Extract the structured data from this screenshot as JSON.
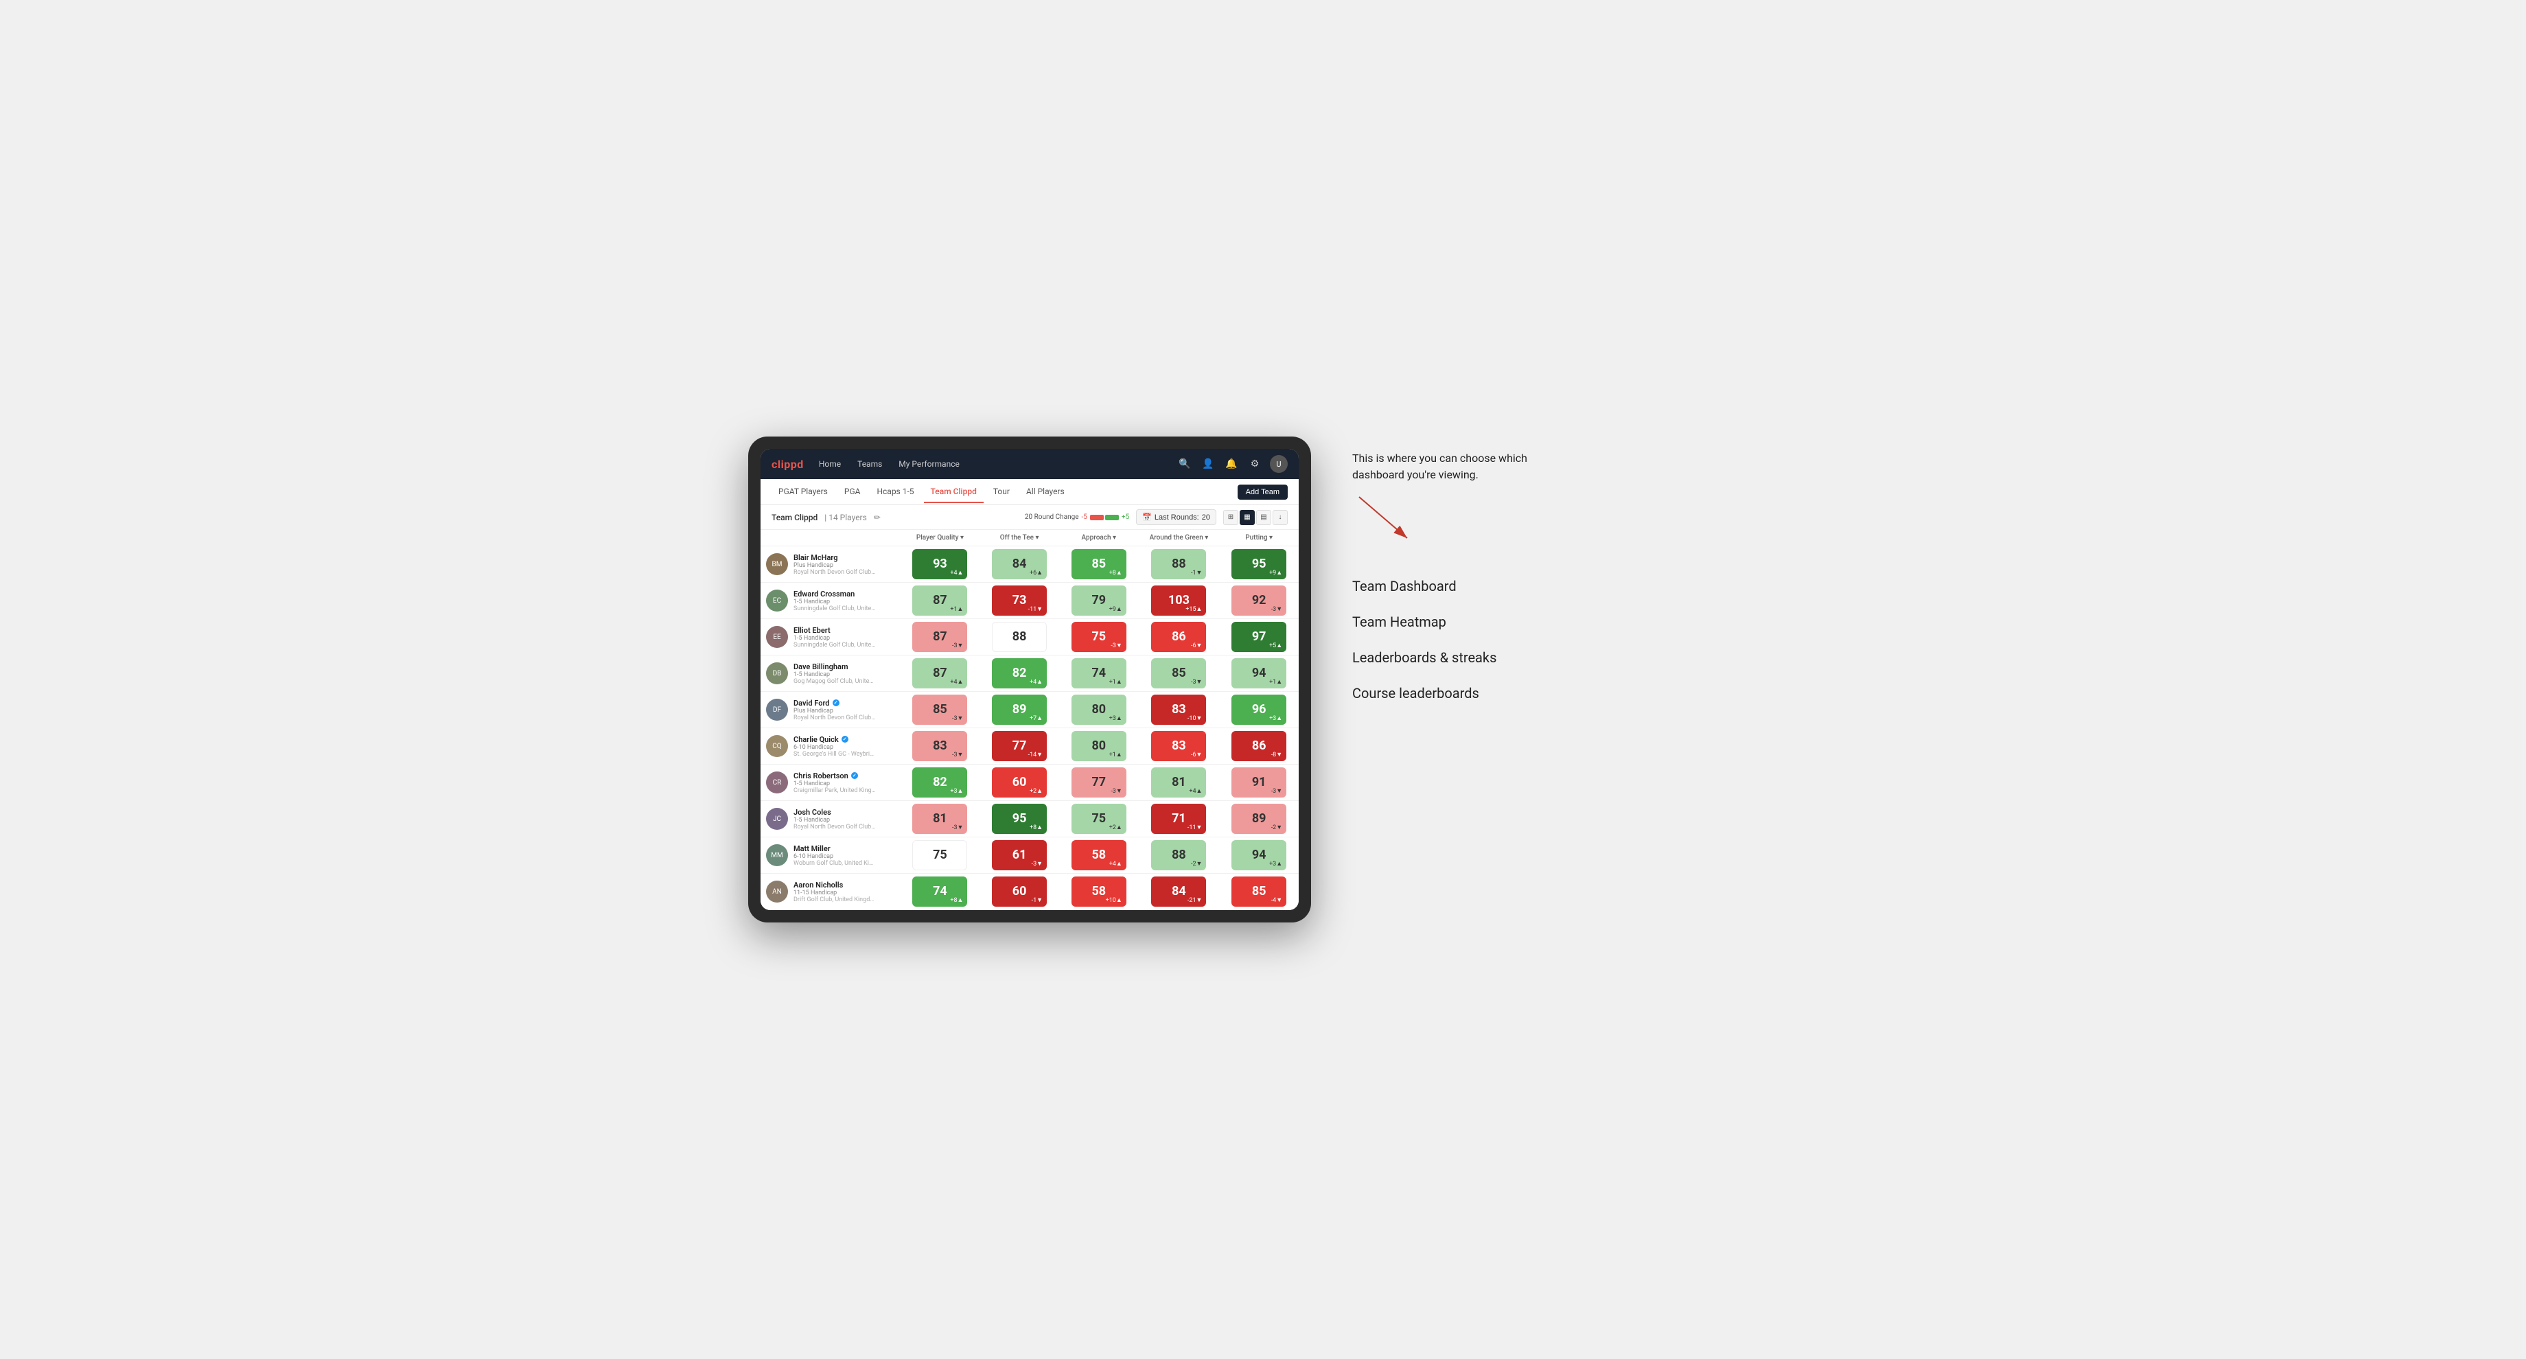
{
  "annotation": {
    "intro_text": "This is where you can choose which dashboard you're viewing.",
    "menu_items": [
      "Team Dashboard",
      "Team Heatmap",
      "Leaderboards & streaks",
      "Course leaderboards"
    ]
  },
  "nav": {
    "logo": "clippd",
    "links": [
      "Home",
      "Teams",
      "My Performance"
    ],
    "icons": [
      "search",
      "user",
      "bell",
      "settings",
      "avatar"
    ]
  },
  "tabs": {
    "items": [
      "PGAT Players",
      "PGA",
      "Hcaps 1-5",
      "Team Clippd",
      "Tour",
      "All Players"
    ],
    "active": "Team Clippd",
    "add_button": "Add Team"
  },
  "team_header": {
    "name": "Team Clippd",
    "separator": "|",
    "count": "14 Players",
    "round_change_label": "20 Round Change",
    "change_neg": "-5",
    "change_pos": "+5",
    "last_rounds_label": "Last Rounds:",
    "last_rounds_value": "20"
  },
  "table": {
    "columns": [
      "Player Quality ▾",
      "Off the Tee ▾",
      "Approach ▾",
      "Around the Green ▾",
      "Putting ▾"
    ],
    "rows": [
      {
        "name": "Blair McHarg",
        "handicap": "Plus Handicap",
        "club": "Royal North Devon Golf Club, United Kingdom",
        "avatar_initials": "BM",
        "avatar_color": "#8B7355",
        "verified": false,
        "scores": [
          {
            "value": 93,
            "change": "+4",
            "dir": "up",
            "color": "green-dark"
          },
          {
            "value": 84,
            "change": "+6",
            "dir": "up",
            "color": "green-light"
          },
          {
            "value": 85,
            "change": "+8",
            "dir": "up",
            "color": "green-mid"
          },
          {
            "value": 88,
            "change": "-1",
            "dir": "down",
            "color": "green-light"
          },
          {
            "value": 95,
            "change": "+9",
            "dir": "up",
            "color": "green-dark"
          }
        ]
      },
      {
        "name": "Edward Crossman",
        "handicap": "1-5 Handicap",
        "club": "Sunningdale Golf Club, United Kingdom",
        "avatar_initials": "EC",
        "avatar_color": "#6B8E6B",
        "verified": false,
        "scores": [
          {
            "value": 87,
            "change": "+1",
            "dir": "up",
            "color": "green-light"
          },
          {
            "value": 73,
            "change": "-11",
            "dir": "down",
            "color": "red-dark"
          },
          {
            "value": 79,
            "change": "+9",
            "dir": "up",
            "color": "green-light"
          },
          {
            "value": 103,
            "change": "+15",
            "dir": "up",
            "color": "red-dark"
          },
          {
            "value": 92,
            "change": "-3",
            "dir": "down",
            "color": "red-light"
          }
        ]
      },
      {
        "name": "Elliot Ebert",
        "handicap": "1-5 Handicap",
        "club": "Sunningdale Golf Club, United Kingdom",
        "avatar_initials": "EE",
        "avatar_color": "#8B6B6B",
        "verified": false,
        "scores": [
          {
            "value": 87,
            "change": "-3",
            "dir": "down",
            "color": "red-light"
          },
          {
            "value": 88,
            "change": "",
            "dir": "",
            "color": "white"
          },
          {
            "value": 75,
            "change": "-3",
            "dir": "down",
            "color": "red-mid"
          },
          {
            "value": 86,
            "change": "-6",
            "dir": "down",
            "color": "red-mid"
          },
          {
            "value": 97,
            "change": "+5",
            "dir": "up",
            "color": "green-dark"
          }
        ]
      },
      {
        "name": "Dave Billingham",
        "handicap": "1-5 Handicap",
        "club": "Gog Magog Golf Club, United Kingdom",
        "avatar_initials": "DB",
        "avatar_color": "#7B8B6B",
        "verified": false,
        "scores": [
          {
            "value": 87,
            "change": "+4",
            "dir": "up",
            "color": "green-light"
          },
          {
            "value": 82,
            "change": "+4",
            "dir": "up",
            "color": "green-mid"
          },
          {
            "value": 74,
            "change": "+1",
            "dir": "up",
            "color": "green-light"
          },
          {
            "value": 85,
            "change": "-3",
            "dir": "down",
            "color": "green-light"
          },
          {
            "value": 94,
            "change": "+1",
            "dir": "up",
            "color": "green-light"
          }
        ]
      },
      {
        "name": "David Ford",
        "handicap": "Plus Handicap",
        "club": "Royal North Devon Golf Club, United Kingdom",
        "avatar_initials": "DF",
        "avatar_color": "#6B7B8B",
        "verified": true,
        "scores": [
          {
            "value": 85,
            "change": "-3",
            "dir": "down",
            "color": "red-light"
          },
          {
            "value": 89,
            "change": "+7",
            "dir": "up",
            "color": "green-mid"
          },
          {
            "value": 80,
            "change": "+3",
            "dir": "up",
            "color": "green-light"
          },
          {
            "value": 83,
            "change": "-10",
            "dir": "down",
            "color": "red-dark"
          },
          {
            "value": 96,
            "change": "+3",
            "dir": "up",
            "color": "green-mid"
          }
        ]
      },
      {
        "name": "Charlie Quick",
        "handicap": "6-10 Handicap",
        "club": "St. George's Hill GC - Weybridge - Surrey, Uni...",
        "avatar_initials": "CQ",
        "avatar_color": "#9B8B6B",
        "verified": true,
        "scores": [
          {
            "value": 83,
            "change": "-3",
            "dir": "down",
            "color": "red-light"
          },
          {
            "value": 77,
            "change": "-14",
            "dir": "down",
            "color": "red-dark"
          },
          {
            "value": 80,
            "change": "+1",
            "dir": "up",
            "color": "green-light"
          },
          {
            "value": 83,
            "change": "-6",
            "dir": "down",
            "color": "red-mid"
          },
          {
            "value": 86,
            "change": "-8",
            "dir": "down",
            "color": "red-dark"
          }
        ]
      },
      {
        "name": "Chris Robertson",
        "handicap": "1-5 Handicap",
        "club": "Craigmillar Park, United Kingdom",
        "avatar_initials": "CR",
        "avatar_color": "#8B6B7B",
        "verified": true,
        "scores": [
          {
            "value": 82,
            "change": "+3",
            "dir": "up",
            "color": "green-mid"
          },
          {
            "value": 60,
            "change": "+2",
            "dir": "up",
            "color": "red-mid"
          },
          {
            "value": 77,
            "change": "-3",
            "dir": "down",
            "color": "red-light"
          },
          {
            "value": 81,
            "change": "+4",
            "dir": "up",
            "color": "green-light"
          },
          {
            "value": 91,
            "change": "-3",
            "dir": "down",
            "color": "red-light"
          }
        ]
      },
      {
        "name": "Josh Coles",
        "handicap": "1-5 Handicap",
        "club": "Royal North Devon Golf Club, United Kingdom",
        "avatar_initials": "JC",
        "avatar_color": "#7B6B8B",
        "verified": false,
        "scores": [
          {
            "value": 81,
            "change": "-3",
            "dir": "down",
            "color": "red-light"
          },
          {
            "value": 95,
            "change": "+8",
            "dir": "up",
            "color": "green-dark"
          },
          {
            "value": 75,
            "change": "+2",
            "dir": "up",
            "color": "green-light"
          },
          {
            "value": 71,
            "change": "-11",
            "dir": "down",
            "color": "red-dark"
          },
          {
            "value": 89,
            "change": "-2",
            "dir": "down",
            "color": "red-light"
          }
        ]
      },
      {
        "name": "Matt Miller",
        "handicap": "6-10 Handicap",
        "club": "Woburn Golf Club, United Kingdom",
        "avatar_initials": "MM",
        "avatar_color": "#6B8B7B",
        "verified": false,
        "scores": [
          {
            "value": 75,
            "change": "",
            "dir": "",
            "color": "white"
          },
          {
            "value": 61,
            "change": "-3",
            "dir": "down",
            "color": "red-dark"
          },
          {
            "value": 58,
            "change": "+4",
            "dir": "up",
            "color": "red-mid"
          },
          {
            "value": 88,
            "change": "-2",
            "dir": "down",
            "color": "green-light"
          },
          {
            "value": 94,
            "change": "+3",
            "dir": "up",
            "color": "green-light"
          }
        ]
      },
      {
        "name": "Aaron Nicholls",
        "handicap": "11-15 Handicap",
        "club": "Drift Golf Club, United Kingdom",
        "avatar_initials": "AN",
        "avatar_color": "#8B7B6B",
        "verified": false,
        "scores": [
          {
            "value": 74,
            "change": "+8",
            "dir": "up",
            "color": "green-mid"
          },
          {
            "value": 60,
            "change": "-1",
            "dir": "down",
            "color": "red-dark"
          },
          {
            "value": 58,
            "change": "+10",
            "dir": "up",
            "color": "red-mid"
          },
          {
            "value": 84,
            "change": "-21",
            "dir": "down",
            "color": "red-dark"
          },
          {
            "value": 85,
            "change": "-4",
            "dir": "down",
            "color": "red-mid"
          }
        ]
      }
    ]
  }
}
